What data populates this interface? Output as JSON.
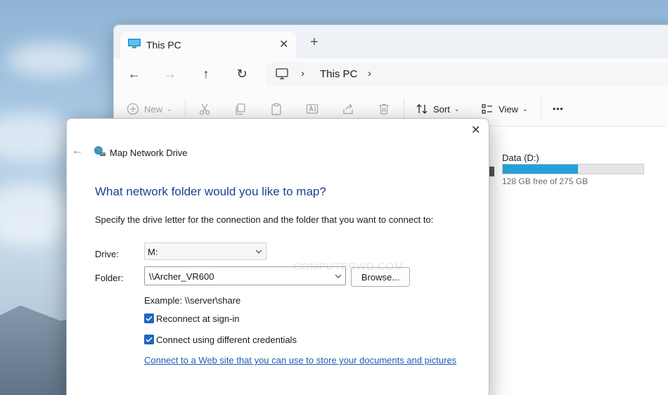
{
  "explorer": {
    "tab_title": "This PC",
    "close_glyph": "✕",
    "new_tab_glyph": "+",
    "nav": {
      "back": "←",
      "forward": "→",
      "up": "↑",
      "refresh": "↻"
    },
    "address": {
      "crumb": "This PC",
      "chevron": "›"
    },
    "toolbar": {
      "new_label": "New",
      "sort_label": "Sort",
      "view_label": "View",
      "more_glyph": "•••",
      "dropdown_glyph": "⌄",
      "icons": [
        "plus-circle-icon",
        "cut-icon",
        "copy-icon",
        "paste-icon",
        "rename-icon",
        "share-icon",
        "delete-icon",
        "sort-icon",
        "view-icon"
      ]
    },
    "drive": {
      "label": "Data (D:)",
      "free_text": "128 GB free of 275 GB",
      "used_fraction": 0.535,
      "fill_color": "#26a0da"
    }
  },
  "dialog": {
    "close_glyph": "✕",
    "back_glyph": "←",
    "title": "Map Network Drive",
    "heading": "What network folder would you like to map?",
    "instructions": "Specify the drive letter for the connection and the folder that you want to connect to:",
    "drive_label": "Drive:",
    "drive_value": "M:",
    "folder_label": "Folder:",
    "folder_value": "\\\\Archer_VR600",
    "browse_label": "Browse...",
    "example": "Example: \\\\server\\share",
    "reconnect_label": "Reconnect at sign-in",
    "reconnect_checked": true,
    "credentials_label": "Connect using different credentials",
    "credentials_checked": true,
    "web_link": "Connect to a Web site that you can use to store your documents and pictures",
    "link_suffix": ".",
    "heading_color": "#1c3f94",
    "link_color": "#1a5fb4",
    "checkbox_color": "#1f66c1"
  },
  "watermark": "COMPUTERWD.COM"
}
